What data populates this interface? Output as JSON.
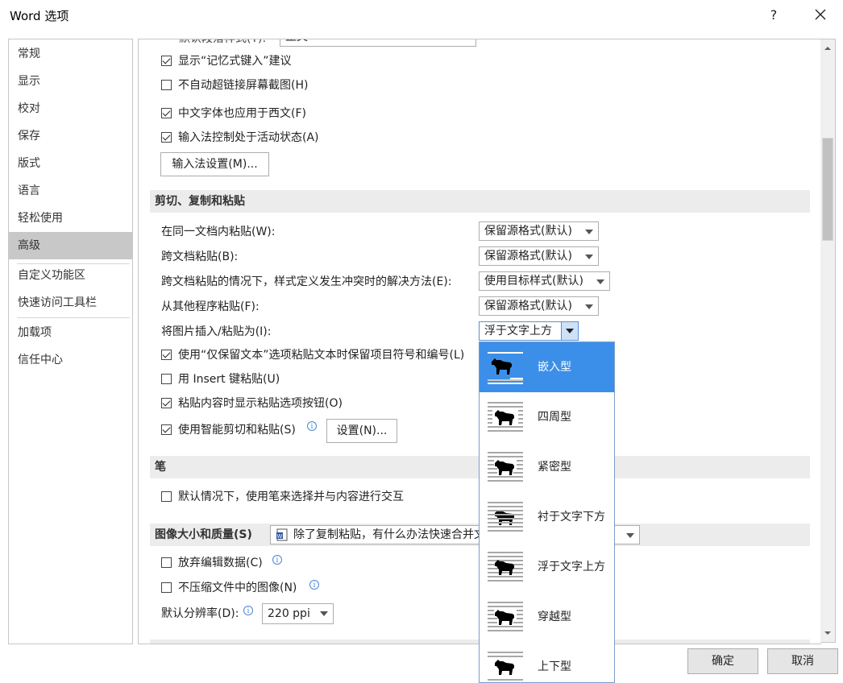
{
  "window": {
    "title": "Word 选项",
    "help": "?"
  },
  "sidebar": {
    "items": [
      {
        "label": "常规"
      },
      {
        "label": "显示"
      },
      {
        "label": "校对"
      },
      {
        "label": "保存"
      },
      {
        "label": "版式"
      },
      {
        "label": "语言"
      },
      {
        "label": "轻松使用"
      },
      {
        "label": "高级"
      },
      {
        "label": "自定义功能区"
      },
      {
        "label": "快速访问工具栏"
      },
      {
        "label": "加载项"
      },
      {
        "label": "信任中心"
      }
    ],
    "selected": "高级"
  },
  "editing": {
    "top_partial_label": "默认段落样式(Y):",
    "top_partial_value": "正文",
    "show_autocomplete": {
      "label": "显示“记忆式键入”建议",
      "checked": true
    },
    "no_hyperlink_screenshot": {
      "label": "不自动超链接屏幕截图(H)",
      "checked": false
    },
    "chinese_font_western": {
      "label": "中文字体也应用于西文(F)",
      "checked": true
    },
    "ime_control": {
      "label": "输入法控制处于活动状态(A)",
      "checked": true
    },
    "ime_settings_button": "输入法设置(M)..."
  },
  "cut_copy_paste": {
    "header": "剪切、复制和粘贴",
    "rows": [
      {
        "label": "在同一文档内粘贴(W):",
        "value": "保留源格式(默认)"
      },
      {
        "label": "跨文档粘贴(B):",
        "value": "保留源格式(默认)"
      },
      {
        "label": "跨文档粘贴的情况下，样式定义发生冲突时的解决方法(E):",
        "value": "使用目标样式(默认)"
      },
      {
        "label": "从其他程序粘贴(F):",
        "value": "保留源格式(默认)"
      },
      {
        "label": "将图片插入/粘贴为(I):",
        "value": "浮于文字上方"
      }
    ],
    "keep_bullets": {
      "label": "使用“仅保留文本”选项粘贴文本时保留项目符号和编号(L)",
      "checked": true
    },
    "insert_key": {
      "label": "用 Insert 键粘贴(U)",
      "checked": false
    },
    "show_paste_options": {
      "label": "粘贴内容时显示粘贴选项按钮(O)",
      "checked": true
    },
    "smart_cut": {
      "label": "使用智能剪切和粘贴(S)",
      "checked": true
    },
    "settings_button": "设置(N)..."
  },
  "pen": {
    "header": "笔",
    "use_pen": {
      "label": "默认情况下，使用笔来选择并与内容进行交互",
      "checked": false
    }
  },
  "image_quality": {
    "header": "图像大小和质量(S)",
    "document_value": "除了复制粘贴，有什么办法快速合并文档",
    "discard_edit": {
      "label": "放弃编辑数据(C)",
      "checked": false
    },
    "no_compress": {
      "label": "不压缩文件中的图像(N)",
      "checked": false
    },
    "resolution_label": "默认分辨率(D):",
    "resolution_value": "220 ppi"
  },
  "wrap_popup": {
    "options": [
      {
        "label": "嵌入型",
        "icon": "inline-wrap-icon"
      },
      {
        "label": "四周型",
        "icon": "square-wrap-icon"
      },
      {
        "label": "紧密型",
        "icon": "tight-wrap-icon"
      },
      {
        "label": "衬于文字下方",
        "icon": "behind-text-icon"
      },
      {
        "label": "浮于文字上方",
        "icon": "in-front-text-icon"
      },
      {
        "label": "穿越型",
        "icon": "through-wrap-icon"
      },
      {
        "label": "上下型",
        "icon": "top-bottom-wrap-icon"
      }
    ],
    "highlighted": "嵌入型"
  },
  "footer": {
    "ok": "确定",
    "cancel": "取消"
  },
  "colors": {
    "accent": "#3c8fe8",
    "sidebar_selected": "#c8c8c8",
    "header_bg": "#ececec"
  }
}
